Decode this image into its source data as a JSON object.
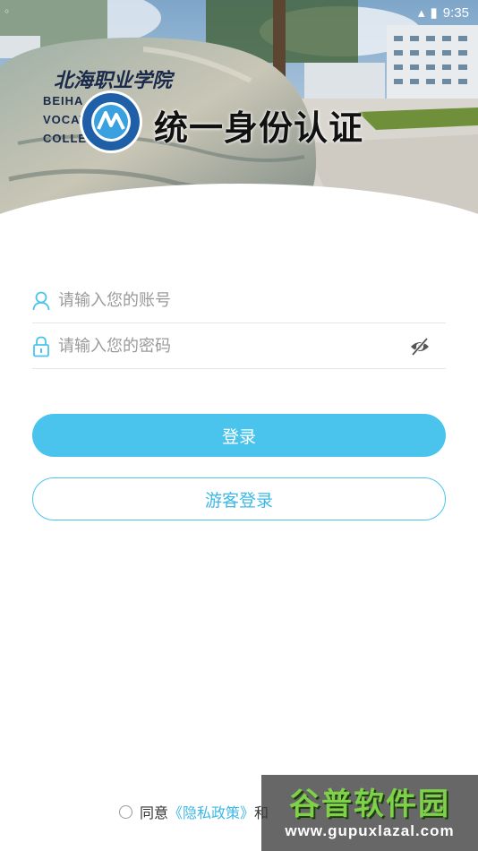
{
  "status_bar": {
    "time": "9:35"
  },
  "header": {
    "school_name_cn": "北海职业学院",
    "school_name_en_lines": [
      "BEIHA",
      "VOCATI",
      "COLLE"
    ],
    "title": "统一身份认证"
  },
  "form": {
    "username": {
      "placeholder": "请输入您的账号",
      "value": "",
      "icon": "user-icon"
    },
    "password": {
      "placeholder": "请输入您的密码",
      "value": "",
      "icon": "lock-icon",
      "toggle_icon": "eye-off-icon"
    }
  },
  "buttons": {
    "login_label": "登录",
    "guest_label": "游客登录"
  },
  "agreement": {
    "prefix": "同意",
    "privacy_link": "《隐私政策》",
    "suffix": "和"
  },
  "watermark": {
    "title": "谷普软件园",
    "url": "www.gupuxlazal.com"
  },
  "colors": {
    "accent": "#4ac4ed",
    "link": "#3db8e6"
  }
}
